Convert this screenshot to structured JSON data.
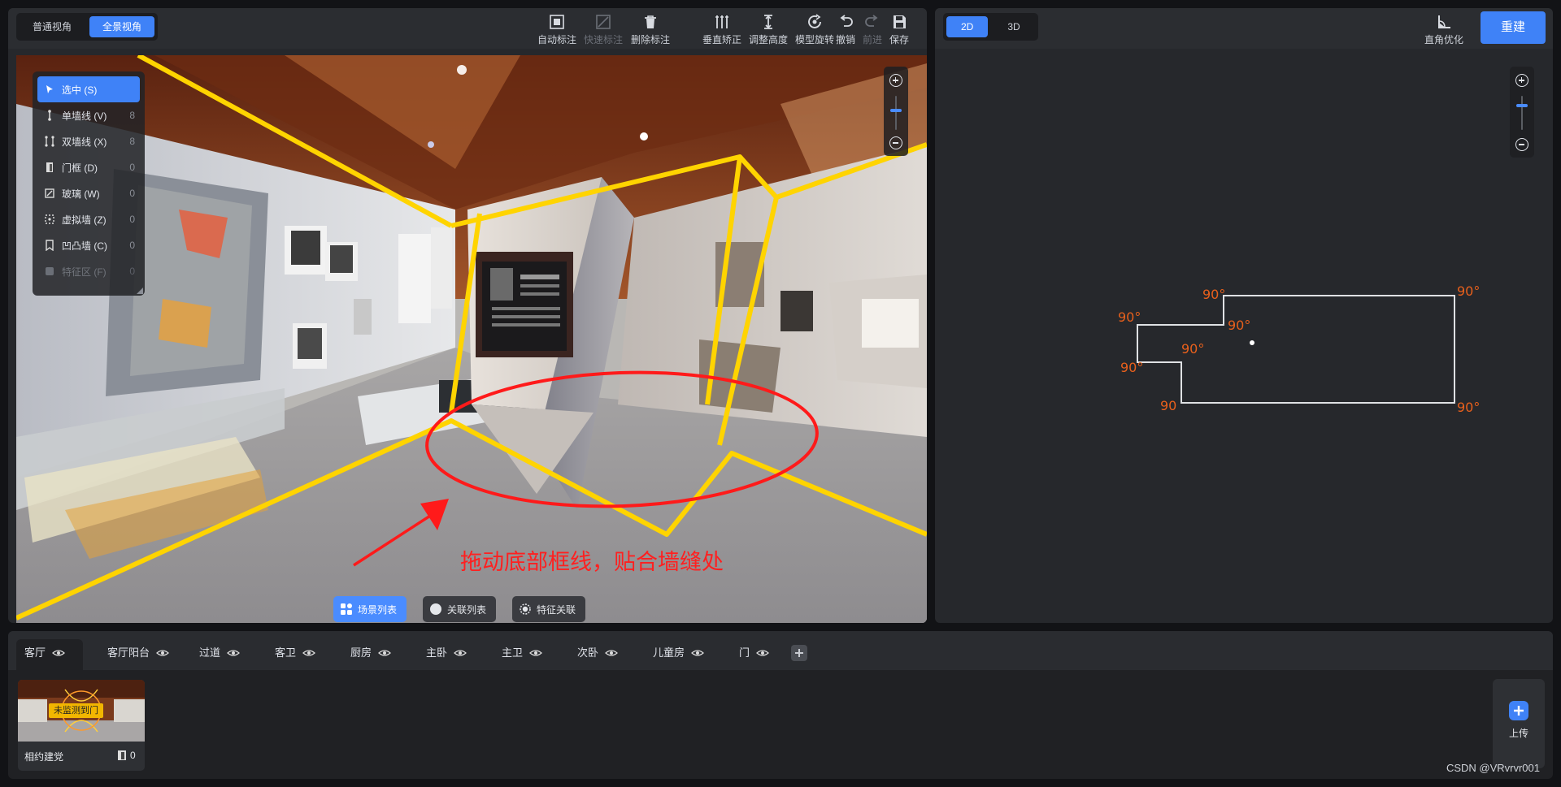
{
  "view_toggle": {
    "normal": "普通视角",
    "panorama": "全景视角"
  },
  "left_tools": [
    {
      "label": "自动标注",
      "icon": "auto-annotate-icon",
      "enabled": true
    },
    {
      "label": "快速标注",
      "icon": "quick-annotate-icon",
      "enabled": false
    },
    {
      "label": "删除标注",
      "icon": "delete-icon",
      "enabled": true
    },
    {
      "label": "垂直矫正",
      "icon": "vertical-correct-icon",
      "enabled": true
    },
    {
      "label": "调整高度",
      "icon": "height-adjust-icon",
      "enabled": true
    },
    {
      "label": "模型旋转",
      "icon": "rotate-icon",
      "enabled": true
    },
    {
      "label": "撤销",
      "icon": "undo-icon",
      "enabled": true
    },
    {
      "label": "前进",
      "icon": "redo-icon",
      "enabled": false
    },
    {
      "label": "保存",
      "icon": "save-icon",
      "enabled": true
    }
  ],
  "mode_list": [
    {
      "label": "选中 (S)",
      "count": ""
    },
    {
      "label": "单墙线 (V)",
      "count": "8"
    },
    {
      "label": "双墙线 (X)",
      "count": "8"
    },
    {
      "label": "门框 (D)",
      "count": "0"
    },
    {
      "label": "玻璃 (W)",
      "count": "0"
    },
    {
      "label": "虚拟墙 (Z)",
      "count": "0"
    },
    {
      "label": "凹凸墙 (C)",
      "count": "0"
    },
    {
      "label": "特征区 (F)",
      "count": "0"
    }
  ],
  "pano_buttons": {
    "scene_list": "场景列表",
    "relation_list": "关联列表",
    "feature_relation": "特征关联"
  },
  "annotation_text": "拖动底部框线，贴合墙缝处",
  "right_toolbar": {
    "mode_2d": "2D",
    "mode_3d": "3D",
    "right_angle": "直角优化",
    "rebuild": "重建"
  },
  "floorplan_angles": [
    "90°",
    "90°",
    "90°",
    "90°",
    "90°",
    "90°",
    "90",
    "90°"
  ],
  "room_tabs": [
    "客厅",
    "客厅阳台",
    "过道",
    "客卫",
    "厨房",
    "主卧",
    "主卫",
    "次卧",
    "儿童房",
    "门"
  ],
  "scene_thumb": {
    "badge": "未监测到门",
    "name": "相约建党",
    "door_count": "0"
  },
  "upload_label": "上传",
  "footer": "CSDN @VRvrvr001",
  "colors": {
    "accent": "#3f82f7",
    "wall_line": "#ffd400",
    "angle_text": "#e8601c",
    "annotation": "#ff2020"
  }
}
